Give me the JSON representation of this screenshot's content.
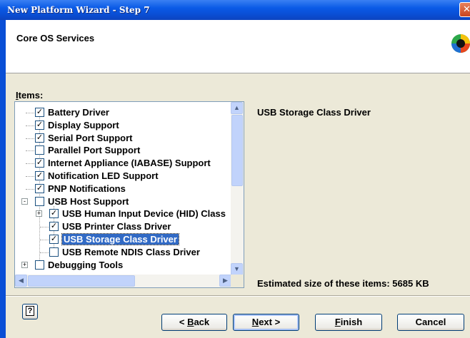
{
  "window": {
    "title": "New Platform Wizard - Step 7",
    "close_glyph": "✕"
  },
  "header": {
    "title": "Core OS Services",
    "logo_icon": "wizard-logo-icon"
  },
  "items": {
    "label_accel": "I",
    "label_rest": "tems:",
    "tree": [
      {
        "label": "Battery Driver",
        "checked": true,
        "indent": 0
      },
      {
        "label": "Display Support",
        "checked": true,
        "indent": 0
      },
      {
        "label": "Serial Port Support",
        "checked": true,
        "indent": 0
      },
      {
        "label": "Parallel Port Support",
        "checked": false,
        "indent": 0
      },
      {
        "label": "Internet Appliance (IABASE) Support",
        "checked": true,
        "indent": 0
      },
      {
        "label": "Notification LED Support",
        "checked": true,
        "indent": 0
      },
      {
        "label": "PNP Notifications",
        "checked": true,
        "indent": 0
      },
      {
        "label": "USB Host Support",
        "checked": false,
        "indent": 0,
        "expander": "-"
      },
      {
        "label": "USB Human Input Device (HID) Class",
        "checked": true,
        "indent": 1,
        "expander": "+"
      },
      {
        "label": "USB Printer Class Driver",
        "checked": true,
        "indent": 1
      },
      {
        "label": "USB Storage Class Driver",
        "checked": true,
        "indent": 1,
        "selected": true
      },
      {
        "label": "USB Remote NDIS Class Driver",
        "checked": false,
        "indent": 1
      },
      {
        "label": "Debugging Tools",
        "checked": false,
        "indent": 0,
        "expander": "+"
      }
    ]
  },
  "description": {
    "title": "USB Storage Class Driver",
    "size_text": "Estimated size of these items: 5685 KB"
  },
  "buttons": {
    "help": "?",
    "back_prefix": "< ",
    "back_accel": "B",
    "back_rest": "ack",
    "next_accel": "N",
    "next_rest": "ext >",
    "finish_accel": "F",
    "finish_rest": "inish",
    "cancel": "Cancel"
  },
  "colors": {
    "titlebar": "#0a5ae6",
    "selection": "#316ac5",
    "checkmark": "#000000"
  }
}
